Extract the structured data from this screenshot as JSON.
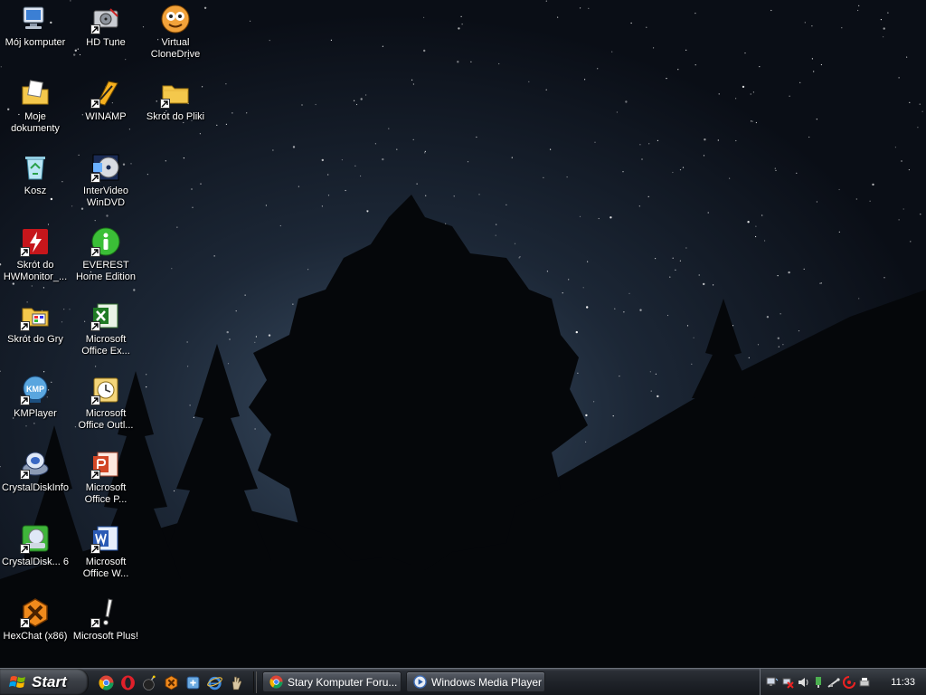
{
  "desktop": {
    "icons": [
      {
        "label": "Mój komputer",
        "icon": "my-computer-icon"
      },
      {
        "label": "HD Tune",
        "icon": "hd-tune-icon"
      },
      {
        "label": "Virtual CloneDrive",
        "icon": "virtual-clonedrive-icon"
      },
      {
        "label": "Moje dokumenty",
        "icon": "my-documents-icon"
      },
      {
        "label": "WINAMP",
        "icon": "winamp-icon"
      },
      {
        "label": "Skrót do Pliki",
        "icon": "folder-icon"
      },
      {
        "label": "Kosz",
        "icon": "recycle-bin-icon"
      },
      {
        "label": "InterVideo WinDVD",
        "icon": "windvd-icon"
      },
      {
        "label": "Skrót do HWMonitor_...",
        "icon": "hwmonitor-icon"
      },
      {
        "label": "EVEREST Home Edition",
        "icon": "everest-icon"
      },
      {
        "label": "Skrót do Gry",
        "icon": "games-folder-icon"
      },
      {
        "label": "Microsoft Office Ex...",
        "icon": "excel-icon"
      },
      {
        "label": "KMPlayer",
        "icon": "kmplayer-icon"
      },
      {
        "label": "Microsoft Office Outl...",
        "icon": "outlook-icon"
      },
      {
        "label": "CrystalDiskInfo",
        "icon": "crystaldiskinfo-icon"
      },
      {
        "label": "Microsoft Office P...",
        "icon": "powerpoint-icon"
      },
      {
        "label": "CrystalDisk... 6",
        "icon": "crystaldiskmark-icon"
      },
      {
        "label": "Microsoft Office W...",
        "icon": "word-icon"
      },
      {
        "label": "HexChat (x86)",
        "icon": "hexchat-icon"
      },
      {
        "label": "Microsoft Plus!",
        "icon": "microsoft-plus-icon"
      }
    ]
  },
  "taskbar": {
    "start_label": "Start",
    "quick_launch": [
      "chrome-icon",
      "opera-icon",
      "bomb-icon",
      "hexchat-icon",
      "network-icon",
      "internet-explorer-icon",
      "gesture-icon"
    ],
    "tasks": [
      {
        "label": "Stary Komputer Foru...",
        "icon": "chrome-icon"
      },
      {
        "label": "Windows Media Player",
        "icon": "windows-media-player-icon"
      }
    ],
    "tray_icons": [
      "network-monitor-icon",
      "network-disconnected-icon",
      "volume-icon",
      "safely-remove-icon",
      "usb-icon",
      "antivirus-icon",
      "printer-icon"
    ],
    "clock": "11:33"
  },
  "colors": {
    "sky_top": "#0a0f18",
    "sky_mid": "#2e3e52",
    "taskbar": "#1f2329",
    "label_text": "#ffffff"
  }
}
